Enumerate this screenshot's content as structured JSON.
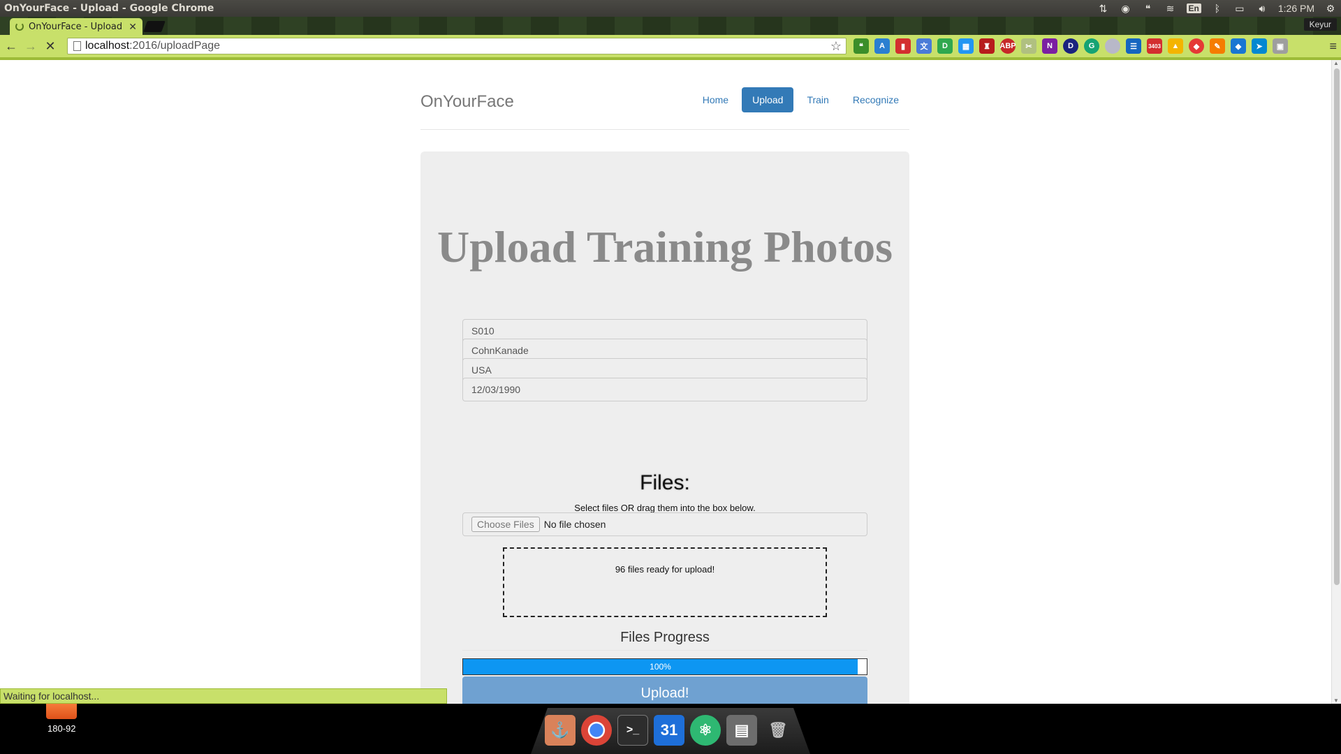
{
  "os_panel": {
    "window_title": "OnYourFace - Upload - Google Chrome",
    "language": "En",
    "clock": "1:26 PM",
    "user": "Keyur"
  },
  "browser": {
    "tab_title": "OnYourFace - Upload",
    "url_host": "localhost",
    "url_path": ":2016/uploadPage",
    "status_text": "Waiting for localhost...",
    "extension_badge": "3403"
  },
  "site": {
    "brand": "OnYourFace",
    "nav": [
      {
        "label": "Home",
        "active": false
      },
      {
        "label": "Upload",
        "active": true
      },
      {
        "label": "Train",
        "active": false
      },
      {
        "label": "Recognize",
        "active": false
      }
    ],
    "heading": "Upload Training Photos",
    "fields": {
      "subject_id": "S010",
      "dataset": "CohnKanade",
      "country": "USA",
      "date": "12/03/1990"
    },
    "files_heading": "Files:",
    "files_help": "Select files OR drag them into the box below.",
    "choose_files_label": "Choose Files",
    "no_file_label": "No file chosen",
    "drop_zone_text": "96 files ready for upload!",
    "progress_title": "Files Progress",
    "progress_value": 100,
    "progress_label": "100%",
    "upload_button": "Upload!"
  },
  "desktop": {
    "folder_label": "180-92",
    "dock_calendar_day": "31"
  }
}
